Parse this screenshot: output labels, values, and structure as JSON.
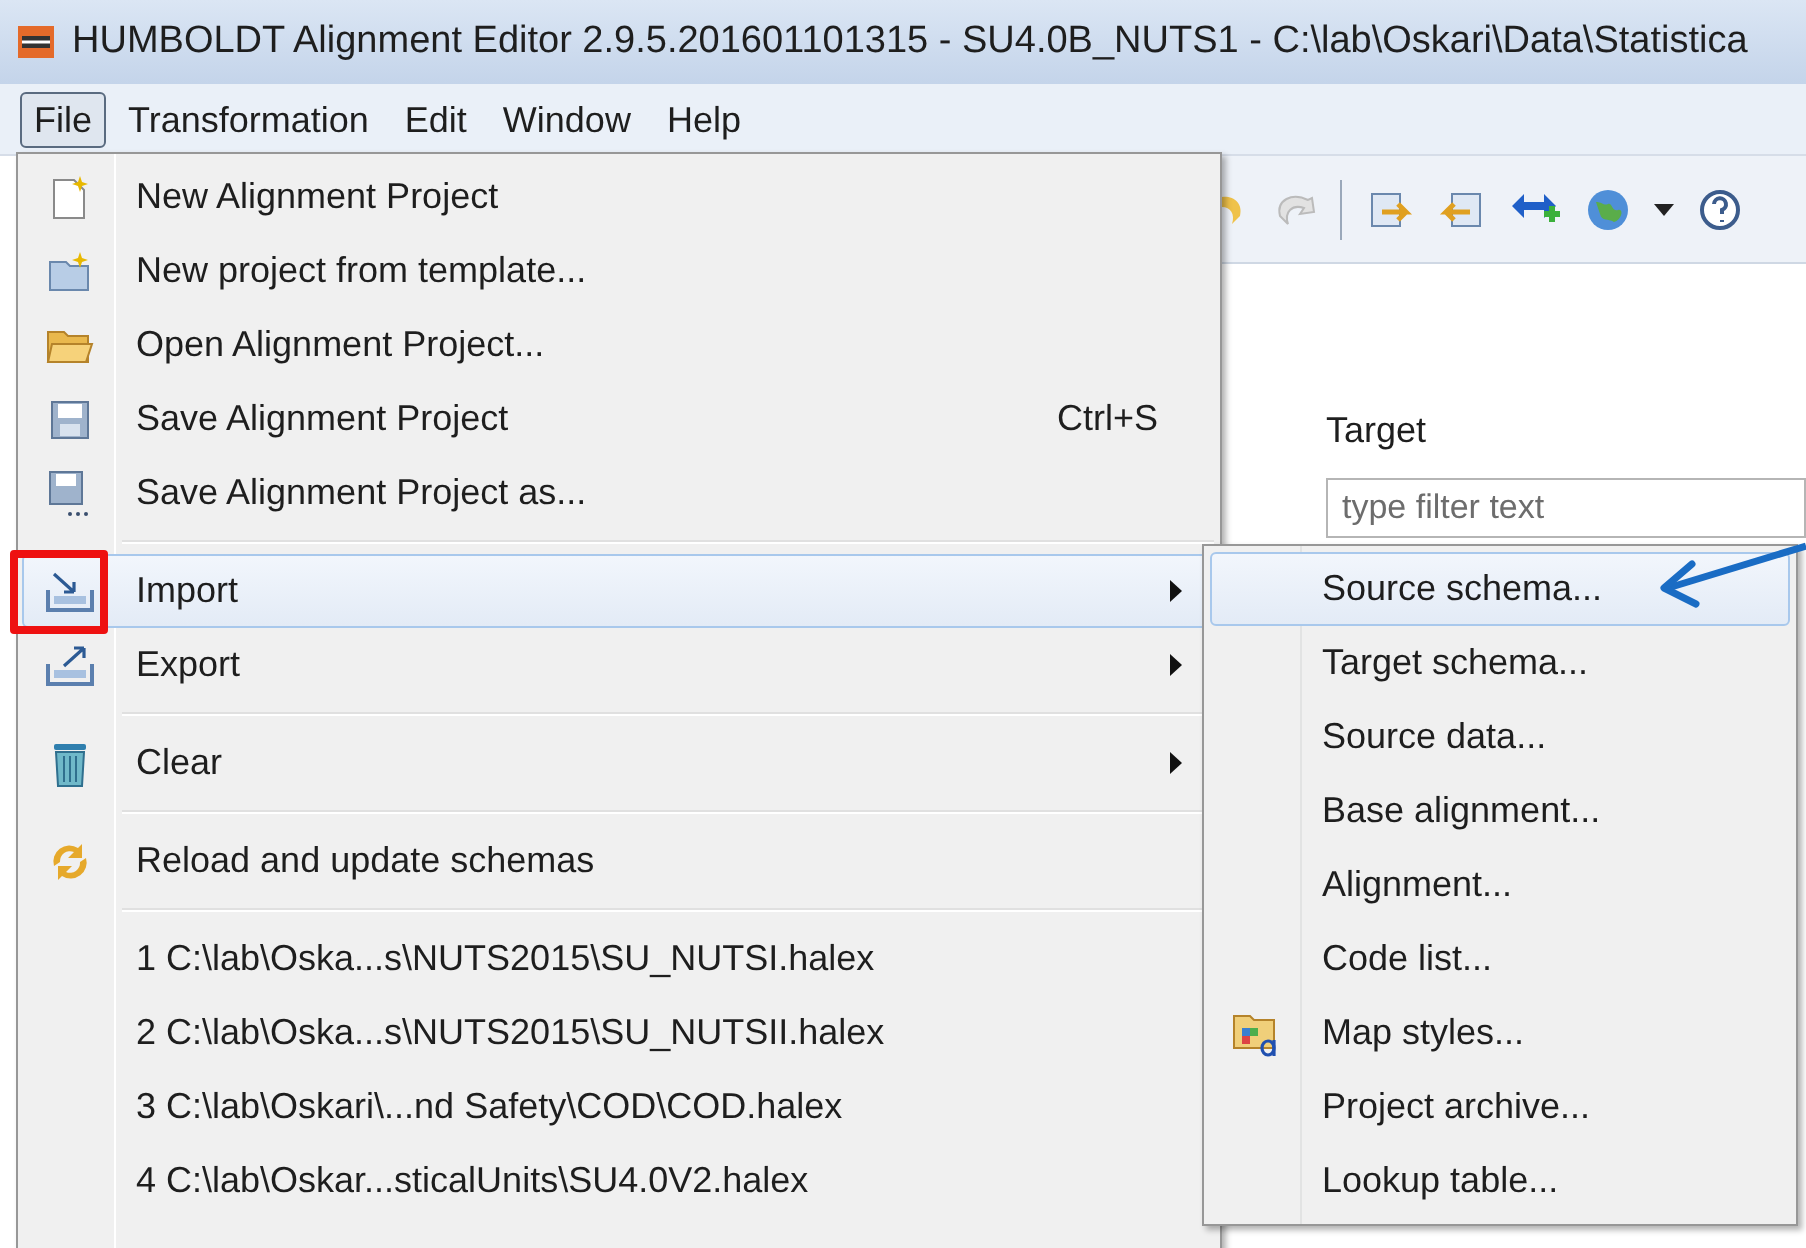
{
  "window": {
    "title": "HUMBOLDT Alignment Editor 2.9.5.201601101315 - SU4.0B_NUTS1 - C:\\lab\\Oskari\\Data\\Statistica"
  },
  "menu_bar": [
    {
      "label": "File",
      "selected": true
    },
    {
      "label": "Transformation",
      "selected": false
    },
    {
      "label": "Edit",
      "selected": false
    },
    {
      "label": "Window",
      "selected": false
    },
    {
      "label": "Help",
      "selected": false
    }
  ],
  "target_panel": {
    "title": "Target",
    "filter": {
      "placeholder": "type filter text"
    }
  },
  "file_menu": [
    {
      "kind": "item",
      "label": "New Alignment Project",
      "selected": false
    },
    {
      "kind": "item",
      "label": "New project from template...",
      "selected": false
    },
    {
      "kind": "item",
      "label": "Open Alignment Project...",
      "selected": false
    },
    {
      "kind": "item",
      "label": "Save Alignment Project",
      "shortcut": "Ctrl+S",
      "selected": false
    },
    {
      "kind": "item",
      "label": "Save Alignment Project as...",
      "selected": false
    },
    {
      "kind": "separator"
    },
    {
      "kind": "submenu",
      "label": "Import",
      "selected": true
    },
    {
      "kind": "submenu",
      "label": "Export",
      "selected": false
    },
    {
      "kind": "separator"
    },
    {
      "kind": "submenu",
      "label": "Clear",
      "selected": false
    },
    {
      "kind": "separator"
    },
    {
      "kind": "item",
      "label": "Reload and update schemas",
      "selected": false
    },
    {
      "kind": "separator"
    },
    {
      "kind": "item",
      "label": "1  C:\\lab\\Oska...s\\NUTS2015\\SU_NUTSI.halex",
      "selected": false
    },
    {
      "kind": "item",
      "label": "2  C:\\lab\\Oska...s\\NUTS2015\\SU_NUTSII.halex",
      "selected": false
    },
    {
      "kind": "item",
      "label": "3  C:\\lab\\Oskari\\...nd Safety\\COD\\COD.halex",
      "selected": false
    },
    {
      "kind": "item",
      "label": "4  C:\\lab\\Oskar...sticalUnits\\SU4.0V2.halex",
      "selected": false
    }
  ],
  "import_submenu": [
    {
      "label": "Source schema...",
      "selected": true
    },
    {
      "label": "Target schema...",
      "selected": false
    },
    {
      "label": "Source data...",
      "selected": false
    },
    {
      "label": "Base alignment...",
      "selected": false
    },
    {
      "label": "Alignment...",
      "selected": false
    },
    {
      "label": "Code list...",
      "selected": false
    },
    {
      "label": "Map styles...",
      "selected": false
    },
    {
      "label": "Project archive...",
      "selected": false
    },
    {
      "label": "Lookup table...",
      "selected": false
    }
  ]
}
